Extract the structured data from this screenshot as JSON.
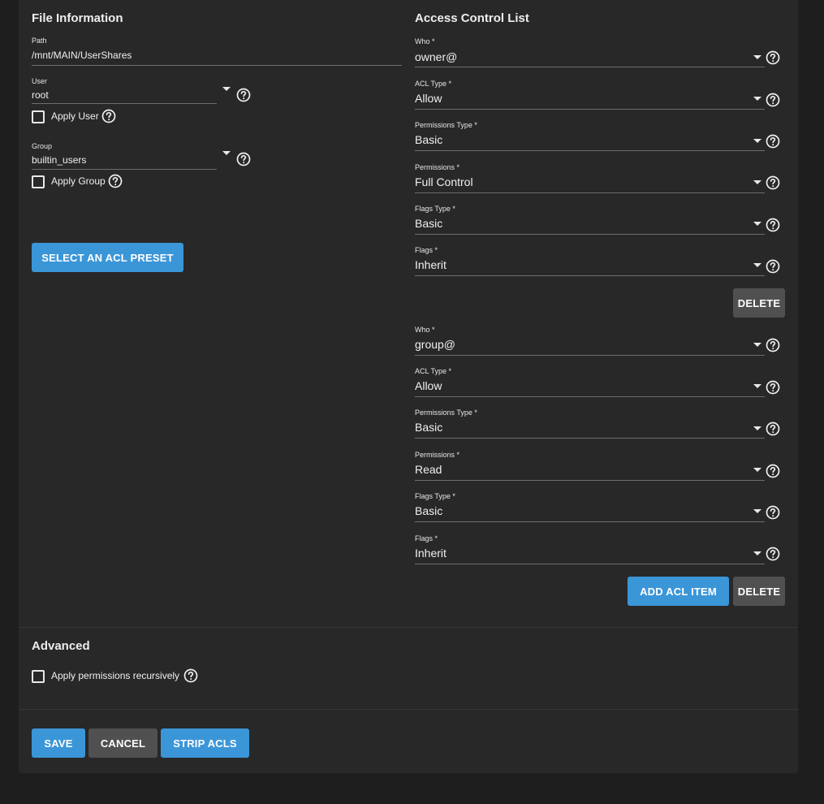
{
  "file_info": {
    "title": "File Information",
    "path_label": "Path",
    "path_value": "/mnt/MAIN/UserShares",
    "user_label": "User",
    "user_value": "root",
    "apply_user_label": "Apply User",
    "group_label": "Group",
    "group_value": "builtin_users",
    "apply_group_label": "Apply Group",
    "preset_button": "SELECT AN ACL PRESET"
  },
  "acl": {
    "title": "Access Control List",
    "labels": {
      "who": "Who *",
      "acl_type": "ACL Type *",
      "perm_type": "Permissions Type *",
      "perms": "Permissions *",
      "flags_type": "Flags Type *",
      "flags": "Flags *"
    },
    "items": [
      {
        "who": "owner@",
        "acl_type": "Allow",
        "perm_type": "Basic",
        "perms": "Full Control",
        "flags_type": "Basic",
        "flags": "Inherit"
      },
      {
        "who": "group@",
        "acl_type": "Allow",
        "perm_type": "Basic",
        "perms": "Read",
        "flags_type": "Basic",
        "flags": "Inherit"
      }
    ],
    "delete_button": "DELETE",
    "add_button": "ADD ACL ITEM"
  },
  "advanced": {
    "title": "Advanced",
    "recursive_label": "Apply permissions recursively"
  },
  "footer": {
    "save": "SAVE",
    "cancel": "CANCEL",
    "strip": "STRIP ACLS"
  },
  "colors": {
    "primary": "#3b96d8",
    "secondary": "#505050",
    "card": "#282828",
    "background": "#1e1e1e"
  },
  "icons": {
    "help": "help-circle-icon",
    "dropdown": "chevron-down-icon",
    "checkbox": "checkbox-unchecked-icon"
  }
}
